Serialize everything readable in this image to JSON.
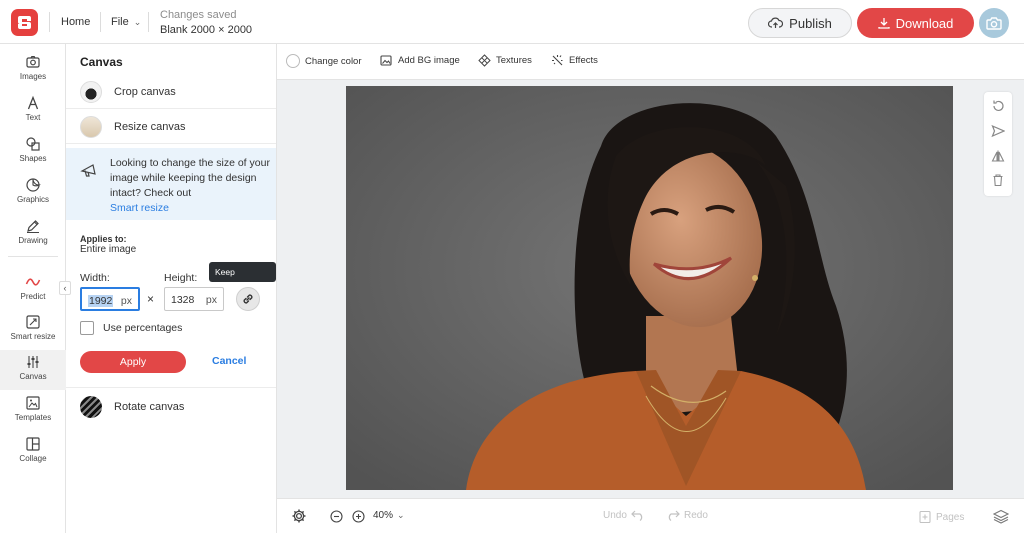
{
  "header": {
    "home_label": "Home",
    "file_label": "File",
    "save_status": "Changes saved",
    "doc_size": "Blank 2000 × 2000",
    "publish_label": "Publish",
    "download_label": "Download"
  },
  "sidebar": {
    "items": [
      {
        "label": "Images",
        "icon": "camera-icon"
      },
      {
        "label": "Text",
        "icon": "text-icon"
      },
      {
        "label": "Shapes",
        "icon": "shapes-icon"
      },
      {
        "label": "Graphics",
        "icon": "graphics-icon"
      },
      {
        "label": "Drawing",
        "icon": "pencil-icon"
      },
      {
        "label": "Predict",
        "icon": "predict-icon"
      },
      {
        "label": "Smart resize",
        "icon": "smart-resize-icon"
      },
      {
        "label": "Canvas",
        "icon": "sliders-icon",
        "active": true
      },
      {
        "label": "Templates",
        "icon": "templates-icon"
      },
      {
        "label": "Collage",
        "icon": "collage-icon"
      }
    ]
  },
  "panel": {
    "title": "Canvas",
    "crop_label": "Crop canvas",
    "resize_label": "Resize canvas",
    "info_text": "Looking to change the size of your image while keeping the design intact? Check out",
    "info_link": "Smart resize",
    "applies_label": "Applies to:",
    "applies_value": "Entire image",
    "width_label": "Width:",
    "height_label": "Height:",
    "width_value": "1992",
    "height_value": "1328",
    "unit": "px",
    "tooltip": "Keep proportions",
    "use_percentages_label": "Use percentages",
    "apply_label": "Apply",
    "cancel_label": "Cancel",
    "rotate_label": "Rotate canvas"
  },
  "canvas_toolbar": {
    "change_color": "Change color",
    "add_bg_image": "Add BG image",
    "textures": "Textures",
    "effects": "Effects"
  },
  "bottom_bar": {
    "zoom": "40%",
    "undo": "Undo",
    "redo": "Redo",
    "pages": "Pages"
  },
  "colors": {
    "accent": "#e24747",
    "link": "#2a7de1",
    "info_bg": "#eaf3fb"
  }
}
